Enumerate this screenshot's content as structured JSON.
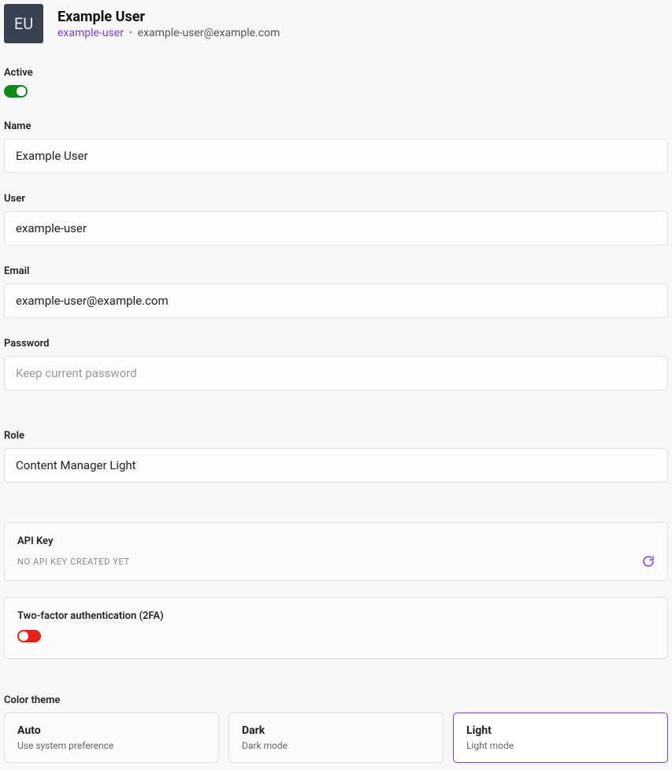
{
  "header": {
    "avatar_initials": "EU",
    "display_name": "Example User",
    "username_link": "example-user",
    "separator": "•",
    "email": "example-user@example.com"
  },
  "fields": {
    "active": {
      "label": "Active",
      "value": true
    },
    "name": {
      "label": "Name",
      "value": "Example User"
    },
    "user": {
      "label": "User",
      "value": "example-user"
    },
    "email": {
      "label": "Email",
      "value": "example-user@example.com"
    },
    "password": {
      "label": "Password",
      "placeholder": "Keep current password"
    },
    "role": {
      "label": "Role",
      "value": "Content Manager Light"
    }
  },
  "api_key": {
    "label": "API Key",
    "empty_text": "No API key created yet"
  },
  "tfa": {
    "label": "Two-factor authentication (2FA)",
    "enabled": false
  },
  "color_theme": {
    "label": "Color theme",
    "options": [
      {
        "title": "Auto",
        "sub": "Use system preference",
        "selected": false
      },
      {
        "title": "Dark",
        "sub": "Dark mode",
        "selected": false
      },
      {
        "title": "Light",
        "sub": "Light mode",
        "selected": true
      }
    ]
  }
}
